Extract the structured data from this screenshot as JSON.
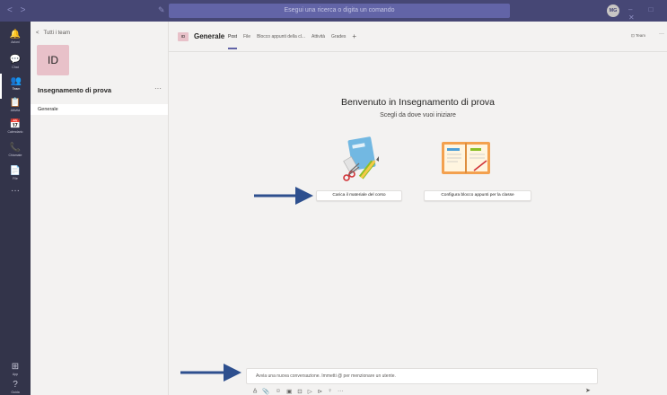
{
  "titlebar": {
    "nav": "< >",
    "compose_icon": "✎",
    "search_placeholder": "Esegui una ricerca o digita un comando",
    "avatar_initials": "MG",
    "window_controls": "– □ ✕"
  },
  "rail": {
    "items": [
      {
        "label": "Azioni",
        "icon": "bell-icon",
        "glyph": "🔔"
      },
      {
        "label": "Chat",
        "icon": "chat-icon",
        "glyph": "💬"
      },
      {
        "label": "Team",
        "icon": "teams-icon",
        "glyph": "👥"
      },
      {
        "label": "Attività",
        "icon": "assignments-icon",
        "glyph": "📋"
      },
      {
        "label": "Calendario",
        "icon": "calendar-icon",
        "glyph": "📅"
      },
      {
        "label": "Chiamate",
        "icon": "phone-icon",
        "glyph": "📞"
      },
      {
        "label": "File",
        "icon": "files-icon",
        "glyph": "📄"
      }
    ],
    "more": "···",
    "bottom": [
      {
        "label": "App",
        "icon": "apps-icon",
        "glyph": "⊞"
      },
      {
        "label": "Guida",
        "icon": "help-icon",
        "glyph": "?"
      }
    ]
  },
  "teams_panel": {
    "back_label": "Tutti i team",
    "team_initials": "ID",
    "team_name": "Insegnamento di prova",
    "more": "···",
    "channels": [
      "Generale"
    ]
  },
  "channel": {
    "badge": "ID",
    "name": "Generale",
    "tabs": [
      "Post",
      "File",
      "Blocco appunti della cl...",
      "Attività",
      "Grades"
    ],
    "add_tab": "+",
    "team_button": "⊡ Team",
    "more": "···"
  },
  "welcome": {
    "title": "Benvenuto in Insegnamento di prova",
    "subtitle": "Scegli da dove vuoi iniziare",
    "upload_button": "Carica il materiale del corso",
    "notebook_button": "Configura blocco appunti per la classe"
  },
  "compose": {
    "placeholder": "Avvia una nuova conversazione. Immetti @ per menzionare un utente.",
    "tools": [
      "A̲",
      "📎",
      "☺",
      "▣",
      "⊡",
      "▷",
      "⊳",
      "♀",
      "···"
    ],
    "send": "➤"
  },
  "colors": {
    "titlebar": "#464775",
    "rail": "#33344a",
    "accent": "#6264a7",
    "team_tile": "#e8c1c9",
    "arrow": "#2d4f8e"
  }
}
